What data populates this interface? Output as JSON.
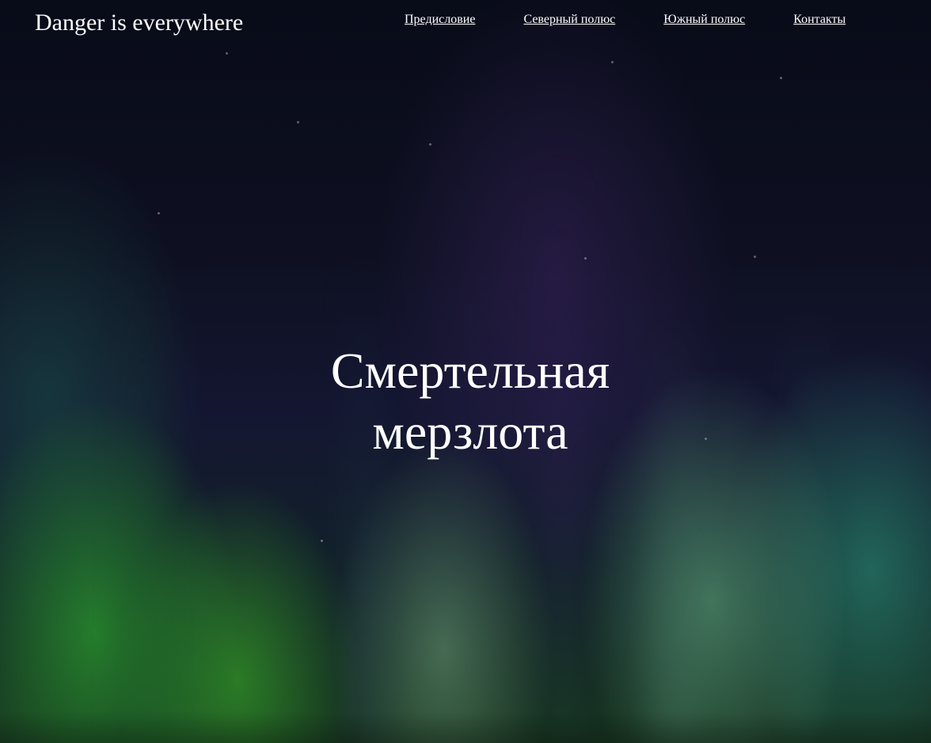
{
  "header": {
    "logo": "Danger is everywhere",
    "nav": [
      {
        "label": "Предисловие"
      },
      {
        "label": "Северный полюс"
      },
      {
        "label": "Южный полюс"
      },
      {
        "label": "Контакты"
      }
    ]
  },
  "hero": {
    "title": "Смертельная мерзлота"
  },
  "colors": {
    "text": "#ffffff",
    "sky_top": "#080b18",
    "aurora_green": "#2e8c2d",
    "aurora_purple": "#372359"
  },
  "background": "aurora-night-sky-image"
}
